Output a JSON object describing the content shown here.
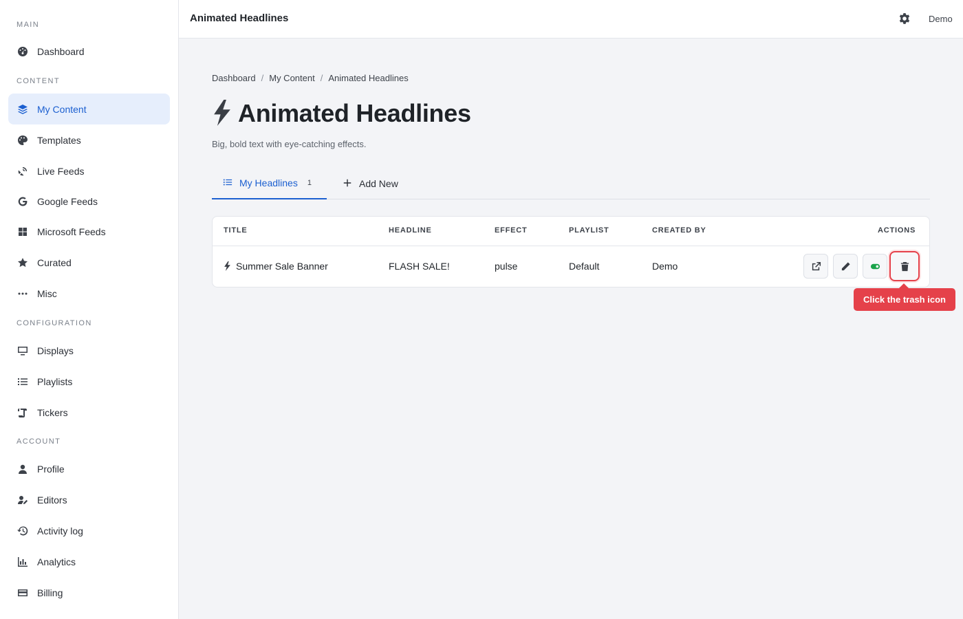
{
  "sidebar": {
    "sections": [
      {
        "label": "MAIN"
      },
      {
        "label": "CONTENT"
      },
      {
        "label": "CONFIGURATION"
      },
      {
        "label": "ACCOUNT"
      }
    ],
    "items": [
      {
        "label": "Dashboard",
        "icon": "dashboard-icon"
      },
      {
        "label": "My Content",
        "icon": "layers-icon",
        "active": true
      },
      {
        "label": "Templates",
        "icon": "palette-icon"
      },
      {
        "label": "Live Feeds",
        "icon": "satellite-dish-icon"
      },
      {
        "label": "Google Feeds",
        "icon": "google-icon"
      },
      {
        "label": "Microsoft Feeds",
        "icon": "windows-icon"
      },
      {
        "label": "Curated",
        "icon": "star-icon"
      },
      {
        "label": "Misc",
        "icon": "ellipsis-icon"
      },
      {
        "label": "Displays",
        "icon": "monitor-icon"
      },
      {
        "label": "Playlists",
        "icon": "list-icon"
      },
      {
        "label": "Tickers",
        "icon": "scroll-icon"
      },
      {
        "label": "Profile",
        "icon": "user-icon"
      },
      {
        "label": "Editors",
        "icon": "user-edit-icon"
      },
      {
        "label": "Activity log",
        "icon": "history-icon"
      },
      {
        "label": "Analytics",
        "icon": "chart-icon"
      },
      {
        "label": "Billing",
        "icon": "credit-card-icon"
      }
    ]
  },
  "topbar": {
    "title": "Animated Headlines",
    "user": "Demo"
  },
  "breadcrumb": [
    "Dashboard",
    "My Content",
    "Animated Headlines"
  ],
  "breadcrumb_sep": "/",
  "page": {
    "title": "Animated Headlines",
    "subtitle": "Big, bold text with eye-catching effects."
  },
  "tabs": [
    {
      "label": "My Headlines",
      "count": "1",
      "active": true
    },
    {
      "label": "Add New"
    }
  ],
  "table": {
    "headers": [
      "TITLE",
      "HEADLINE",
      "EFFECT",
      "PLAYLIST",
      "CREATED BY",
      "ACTIONS"
    ],
    "rows": [
      {
        "title": "Summer Sale Banner",
        "headline": "FLASH SALE!",
        "effect": "pulse",
        "playlist": "Default",
        "created_by": "Demo"
      }
    ]
  },
  "tooltip": "Click the trash icon",
  "colors": {
    "accent": "#1b5fd0",
    "active_bg": "#e6eefc",
    "toggle_on": "#1aa34a",
    "highlight": "#e5414a"
  }
}
